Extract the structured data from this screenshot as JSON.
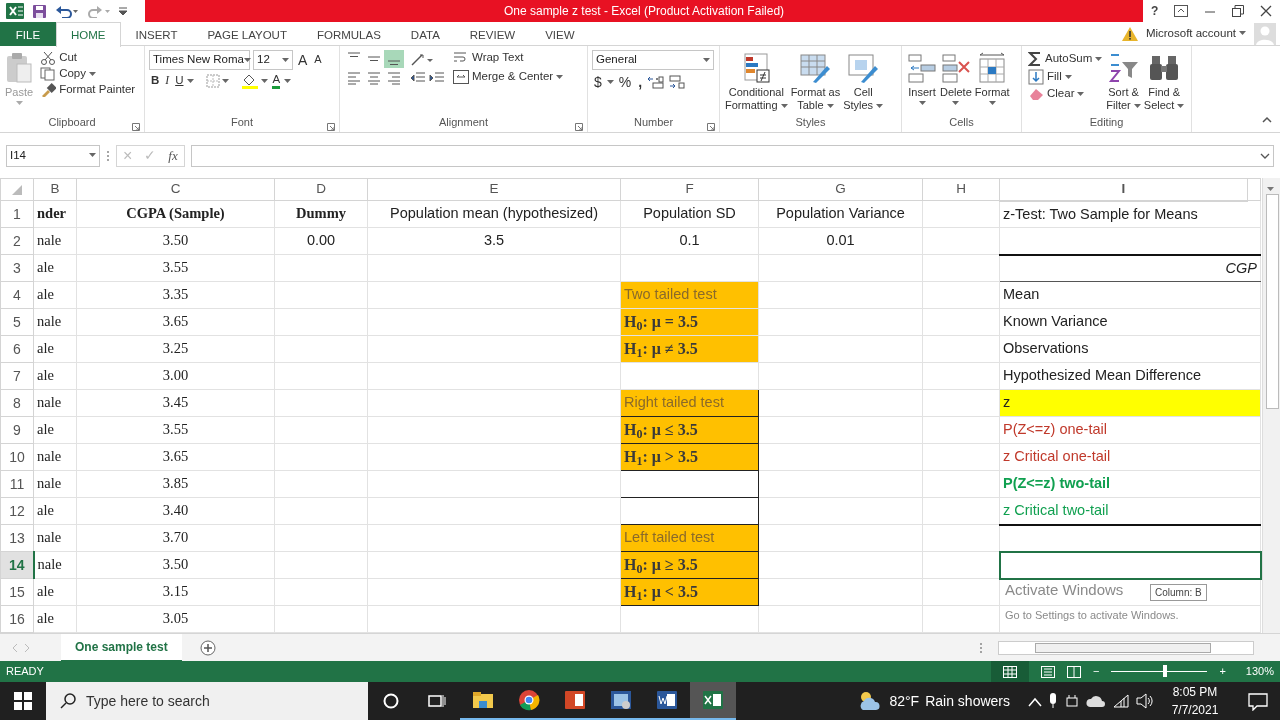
{
  "title_bar": {
    "title": "One sample z test -  Excel (Product Activation Failed)",
    "help": "?"
  },
  "ribbon_tabs": [
    {
      "label": "FILE",
      "kind": "file",
      "selected": false
    },
    {
      "label": "HOME",
      "kind": "tab",
      "selected": true
    },
    {
      "label": "INSERT",
      "kind": "tab",
      "selected": false
    },
    {
      "label": "PAGE LAYOUT",
      "kind": "tab",
      "selected": false
    },
    {
      "label": "FORMULAS",
      "kind": "tab",
      "selected": false
    },
    {
      "label": "DATA",
      "kind": "tab",
      "selected": false
    },
    {
      "label": "REVIEW",
      "kind": "tab",
      "selected": false
    },
    {
      "label": "VIEW",
      "kind": "tab",
      "selected": false
    }
  ],
  "account": "Microsoft account",
  "clipboard": {
    "paste": "Paste",
    "cut": "Cut",
    "copy": "Copy",
    "format_painter": "Format Painter",
    "label": "Clipboard"
  },
  "font": {
    "name": "Times New Roma",
    "size": "12",
    "grow": "A",
    "shrink": "A",
    "bold": "B",
    "italic": "I",
    "underline": "U",
    "font_color_button": "A",
    "label": "Font"
  },
  "alignment": {
    "vertical": [
      {
        "selected": false
      },
      {
        "selected": false
      },
      {
        "selected": true
      }
    ],
    "wrap": "Wrap Text",
    "merge": "Merge & Center",
    "label": "Alignment"
  },
  "number": {
    "format": "General",
    "currency": "$",
    "percent": "%",
    "comma": ",",
    "label": "Number"
  },
  "styles": {
    "conditional": [
      "Conditional",
      "Formatting"
    ],
    "table": [
      "Format as",
      "Table"
    ],
    "cell": [
      "Cell",
      "Styles"
    ],
    "label": "Styles"
  },
  "cells": {
    "insert": "Insert",
    "delete": "Delete",
    "format": "Format",
    "label": "Cells"
  },
  "editing": {
    "autosum": "AutoSum",
    "fill": "Fill",
    "clear": "Clear",
    "sort": [
      "Sort &",
      "Filter"
    ],
    "find": [
      "Find &",
      "Select"
    ],
    "label": "Editing"
  },
  "formula_bar": {
    "name_box": "I14",
    "cancel": "×",
    "enter": "✓",
    "fx": "fx"
  },
  "sheet": {
    "columns": [
      {
        "label": "B",
        "selected": false
      },
      {
        "label": "C",
        "selected": false
      },
      {
        "label": "D",
        "selected": false
      },
      {
        "label": "E",
        "selected": false
      },
      {
        "label": "F",
        "selected": false
      },
      {
        "label": "G",
        "selected": false
      },
      {
        "label": "H",
        "selected": false
      },
      {
        "label": "I",
        "selected": true
      }
    ],
    "rows": [
      {
        "number": "1",
        "selected": false,
        "B": {
          "text": "nder",
          "kind": "heading"
        },
        "C": {
          "text": "CGPA (Sample)",
          "kind": "heading"
        },
        "D": {
          "text": "Dummy",
          "kind": "heading"
        },
        "E": {
          "text": "Population mean (hypothesized)",
          "kind": "value"
        },
        "F": {
          "text": "Population SD",
          "kind": "value"
        },
        "G": {
          "text": "Population Variance",
          "kind": "value"
        },
        "I": {
          "text": "z-Test: Two Sample for Means",
          "kind": "plain"
        }
      },
      {
        "number": "2",
        "selected": false,
        "B": {
          "text": "nale",
          "kind": "entry"
        },
        "C": {
          "text": "3.50",
          "kind": "entry"
        },
        "D": {
          "text": "0.00",
          "kind": "value"
        },
        "E": {
          "text": "3.5",
          "kind": "value"
        },
        "F": {
          "text": "0.1",
          "kind": "value"
        },
        "G": {
          "text": "0.01",
          "kind": "value"
        },
        "I": {
          "kind": "rule"
        }
      },
      {
        "number": "3",
        "selected": false,
        "B": {
          "text": "ale",
          "kind": "entry"
        },
        "C": {
          "text": "3.55",
          "kind": "entry"
        },
        "I": {
          "text": "CGP",
          "kind": "caption"
        }
      },
      {
        "number": "4",
        "selected": false,
        "B": {
          "text": "ale",
          "kind": "entry"
        },
        "C": {
          "text": "3.35",
          "kind": "entry"
        },
        "F": {
          "text": "Two tailed test",
          "kind": "test"
        },
        "I": {
          "text": "Mean",
          "kind": "plain"
        }
      },
      {
        "number": "5",
        "selected": false,
        "B": {
          "text": "nale",
          "kind": "entry"
        },
        "C": {
          "text": "3.65",
          "kind": "entry"
        },
        "F": {
          "text": "H$_{0}$: μ = 3.5",
          "kind": "hypothesis"
        },
        "I": {
          "text": "Known Variance",
          "kind": "plain"
        }
      },
      {
        "number": "6",
        "selected": false,
        "B": {
          "text": "ale",
          "kind": "entry"
        },
        "C": {
          "text": "3.25",
          "kind": "entry"
        },
        "F": {
          "text": "H$_{1}$: μ ≠ 3.5",
          "kind": "hypothesis"
        },
        "I": {
          "text": "Observations",
          "kind": "plain"
        }
      },
      {
        "number": "7",
        "selected": false,
        "B": {
          "text": "ale",
          "kind": "entry"
        },
        "C": {
          "text": "3.00",
          "kind": "entry"
        },
        "I": {
          "text": "Hypothesized Mean Difference",
          "kind": "plain"
        }
      },
      {
        "number": "8",
        "selected": false,
        "B": {
          "text": "nale",
          "kind": "entry"
        },
        "C": {
          "text": "3.45",
          "kind": "entry"
        },
        "F": {
          "text": "Right tailed test",
          "kind": "boxedtest"
        },
        "I": {
          "text": "z",
          "kind": "highlight"
        }
      },
      {
        "number": "9",
        "selected": false,
        "B": {
          "text": "ale",
          "kind": "entry"
        },
        "C": {
          "text": "3.55",
          "kind": "entry"
        },
        "F": {
          "text": "H$_{0}$: μ ≤ 3.5",
          "kind": "boxedhypothesis"
        },
        "I": {
          "text": "P(Z<=z) one-tail",
          "kind": "alert"
        }
      },
      {
        "number": "10",
        "selected": false,
        "B": {
          "text": "nale",
          "kind": "entry"
        },
        "C": {
          "text": "3.65",
          "kind": "entry"
        },
        "F": {
          "text": "H$_{1}$: μ > 3.5",
          "kind": "boxedhypothesis"
        },
        "I": {
          "text": "z Critical one-tail",
          "kind": "alert"
        }
      },
      {
        "number": "11",
        "selected": false,
        "B": {
          "text": "nale",
          "kind": "entry"
        },
        "C": {
          "text": "3.85",
          "kind": "entry"
        },
        "F": {
          "kind": "blank"
        },
        "I": {
          "text": "P(Z<=z) two-tail",
          "kind": "key"
        }
      },
      {
        "number": "12",
        "selected": false,
        "B": {
          "text": "ale",
          "kind": "entry"
        },
        "C": {
          "text": "3.40",
          "kind": "entry"
        },
        "F": {
          "kind": "blank"
        },
        "I": {
          "text": "z Critical two-tail",
          "kind": "note"
        }
      },
      {
        "number": "13",
        "selected": false,
        "B": {
          "text": "nale",
          "kind": "entry"
        },
        "C": {
          "text": "3.70",
          "kind": "entry"
        },
        "F": {
          "text": "Left tailed test",
          "kind": "boxedtest"
        }
      },
      {
        "number": "14",
        "selected": true,
        "B": {
          "text": "nale",
          "kind": "entry"
        },
        "C": {
          "text": "3.50",
          "kind": "entry"
        },
        "F": {
          "text": "H$_{0}$: μ ≥ 3.5",
          "kind": "boxedhypothesis"
        },
        "I": {
          "kind": "active"
        }
      },
      {
        "number": "15",
        "selected": false,
        "B": {
          "text": "ale",
          "kind": "entry"
        },
        "C": {
          "text": "3.15",
          "kind": "entry"
        },
        "F": {
          "text": "H$_{1}$: μ < 3.5",
          "kind": "boxedhypothesis"
        }
      },
      {
        "number": "16",
        "selected": false,
        "B": {
          "text": "ale",
          "kind": "entry"
        },
        "C": {
          "text": "3.05",
          "kind": "entry"
        }
      }
    ]
  },
  "sheet_tabs": [
    {
      "label": "One sample test",
      "selected": true
    }
  ],
  "overlay": {
    "activate": "Activate Windows",
    "activate_hint": "Go to Settings to activate Windows.",
    "tooltip": "Column: B"
  },
  "status_bar": {
    "mode": "READY",
    "zoom_out": "−",
    "zoom": {
      "level": 0.54
    },
    "zoom_in": "+",
    "zoom_reading": "130%"
  },
  "taskbar": {
    "search": {
      "placeholder": "Type here to search"
    },
    "apps": [
      {
        "selected": false
      },
      {
        "selected": false
      },
      {
        "selected": false
      },
      {
        "selected": false
      },
      {
        "selected": false
      },
      {
        "selected": true
      }
    ],
    "weather": {
      "temperature": "82°F",
      "condition": "Rain showers"
    },
    "time": "8:05 PM",
    "date": "7/7/2021"
  }
}
